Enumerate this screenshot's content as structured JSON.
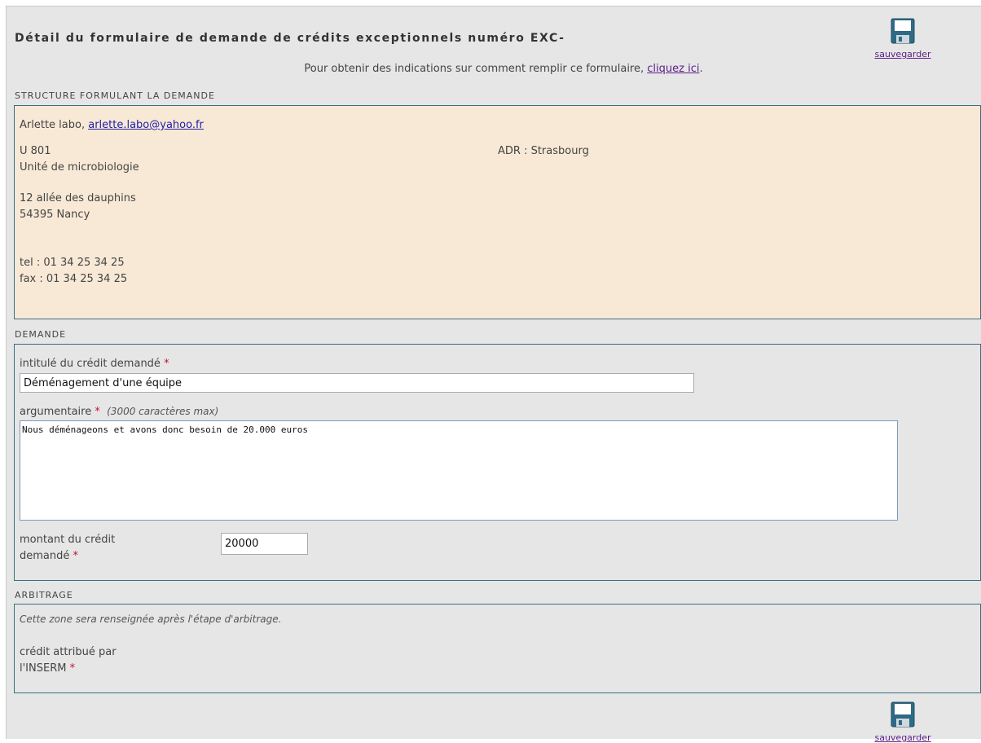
{
  "header": {
    "title": "Détail du formulaire de demande de crédits exceptionnels numéro EXC-",
    "hint_text": "Pour obtenir des indications sur comment remplir ce formulaire, ",
    "hint_link": "cliquez ici",
    "hint_suffix": ".",
    "save_label": "sauvegarder"
  },
  "structure": {
    "section_title": "STRUCTURE FORMULANT LA DEMANDE",
    "contact_name": "Arlette labo, ",
    "contact_email": "arlette.labo@yahoo.fr",
    "unit_code": "U 801",
    "unit_name": "Unité de microbiologie",
    "adr": "ADR : Strasbourg",
    "address_line1": "12 allée des dauphins",
    "address_line2": "54395 Nancy",
    "tel": "tel : 01 34 25 34 25",
    "fax": "fax : 01 34 25 34 25"
  },
  "demande": {
    "section_title": "DEMANDE",
    "intitule_label": "intitulé du crédit demandé",
    "intitule_value": "Déménagement d'une équipe",
    "argumentaire_label": "argumentaire",
    "argumentaire_note": "(3000 caractères max)",
    "argumentaire_value": "Nous déménageons et avons donc besoin de 20.000 euros",
    "montant_label_line1": "montant du crédit",
    "montant_label_line2": "demandé",
    "montant_value": "20000",
    "required_mark": "*"
  },
  "arbitrage": {
    "section_title": "ARBITRAGE",
    "note": "Cette zone sera renseignée après l'étape d'arbitrage.",
    "credit_label_line1": "crédit attribué par",
    "credit_label_line2": "l'INSERM"
  },
  "footer": {
    "save_label": "sauvegarder"
  },
  "colors": {
    "background": "#e6e6e6",
    "structure_bg": "#f8e9d6",
    "box_border": "#3b6f7f",
    "required": "#c8102e",
    "link": "#5a1f86"
  },
  "icons": {
    "save": "floppy-disk-icon"
  }
}
